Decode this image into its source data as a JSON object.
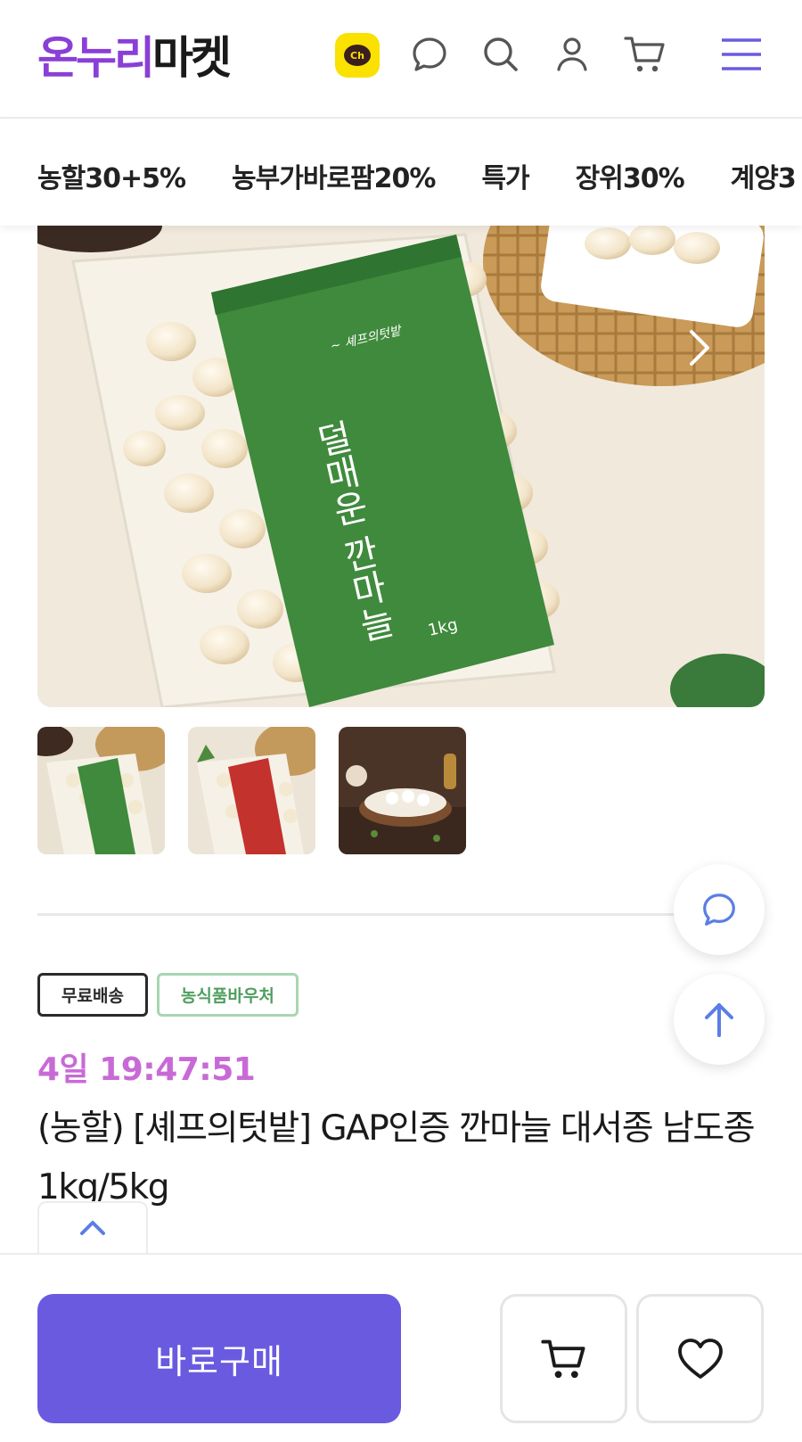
{
  "header": {
    "logo_part1": "온누리",
    "logo_part2": "마켓",
    "icons": [
      "kakao-channel-icon",
      "chat-icon",
      "search-icon",
      "user-icon",
      "cart-icon",
      "menu-icon"
    ],
    "kakao_label": "Ch"
  },
  "categories": [
    "농할30+5%",
    "농부가바로팜20%",
    "특가",
    "장위30%",
    "계양3"
  ],
  "product": {
    "image_package_title": "덜매운 깐마늘",
    "image_package_weight": "1kg",
    "badges": {
      "free_shipping": "무료배송",
      "voucher": "농식품바우처"
    },
    "timer": "4일 19:47:51",
    "title": "(농할) [셰프의텃밭] GAP인증 깐마늘 대서종 남도종 1kg/5kg"
  },
  "bottom_bar": {
    "buy_label": "바로구매"
  },
  "colors": {
    "brand_purple": "#8a3fd6",
    "buy_button": "#6a5ae0",
    "timer": "#c86ad6",
    "voucher_green": "#4f9e5f",
    "icon_blue": "#5b7ee5",
    "kakao_yellow": "#fae100"
  }
}
